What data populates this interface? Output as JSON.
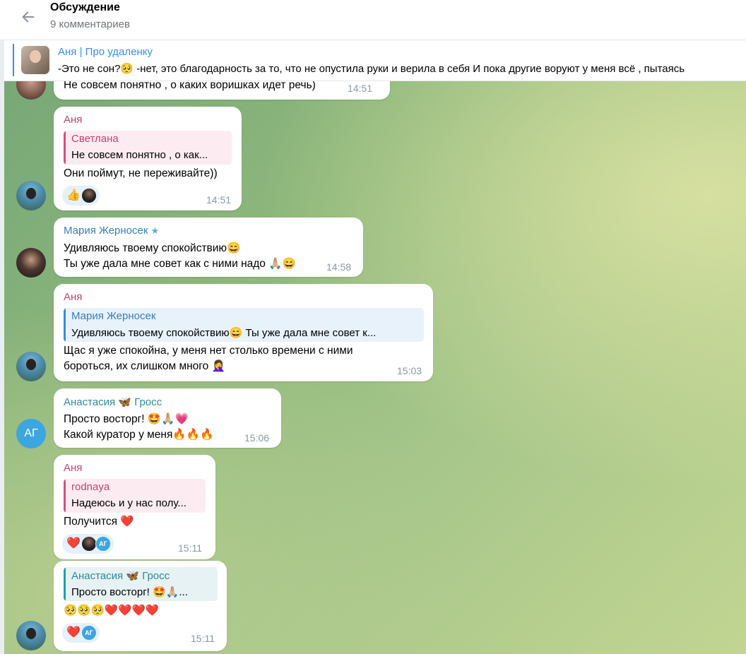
{
  "header": {
    "title": "Обсуждение",
    "subtitle": "9 комментариев"
  },
  "pinned": {
    "title": "Аня | Про удаленку",
    "text": "-Это не сон?🥺  -нет, это благодарность за то, что не опустила руки и верила в себя  И пока другие воруют у меня всё , пытаясь"
  },
  "messages": [
    {
      "text": "Не совсем понятно , о каких воришках идет речь)",
      "time": "14:51"
    },
    {
      "sender": "Аня",
      "quote_name": "Светлана",
      "quote_text": "Не совсем понятно , о как...",
      "text": "Они поймут, не переживайте))",
      "reactions": "👍",
      "time": "14:51"
    },
    {
      "sender": "Мария Жерносек",
      "sender_badge": "★",
      "line1": "Удивляюсь твоему спокойствию😄",
      "line2": "Ты уже дала мне совет как с ними надо 🙏🏼😄",
      "time": "14:58"
    },
    {
      "sender": "Аня",
      "quote_name": "Мария Жерносек",
      "quote_text": "Удивляюсь твоему спокойствию😄  Ты уже дала мне совет к...",
      "line1": "Щас я уже спокойна, у меня нет столько времени с ними",
      "line2": "бороться, их слишком много 🤦‍♀️",
      "time": "15:03"
    },
    {
      "sender": "Анастасия 🦋 Гросс",
      "line1": "Просто восторг! 🤩🙏🏼💗",
      "line2": "Какой куратор у меня🔥🔥🔥",
      "time": "15:06",
      "avatar_initials": "АГ"
    },
    {
      "sender": "Аня",
      "quote_name": "rodnaya",
      "quote_text": "Надеюсь и у нас полу...",
      "text": "Получится ❤️",
      "reactions": "❤️",
      "reaction_ag": "АГ",
      "time": "15:11"
    },
    {
      "quote_name": "Анастасия 🦋 Гросс",
      "quote_text": "Просто восторг! 🤩🙏🏼...",
      "text": "🥺🥺🥺❤️❤️❤️❤️",
      "reactions": "❤️",
      "reaction_ag": "АГ",
      "time": "15:11"
    }
  ],
  "colors": {
    "accent": "#3390ec",
    "pink_name": "#c4456f",
    "blue_name": "#3a7dbd",
    "teal_name": "#2a8c9a"
  }
}
